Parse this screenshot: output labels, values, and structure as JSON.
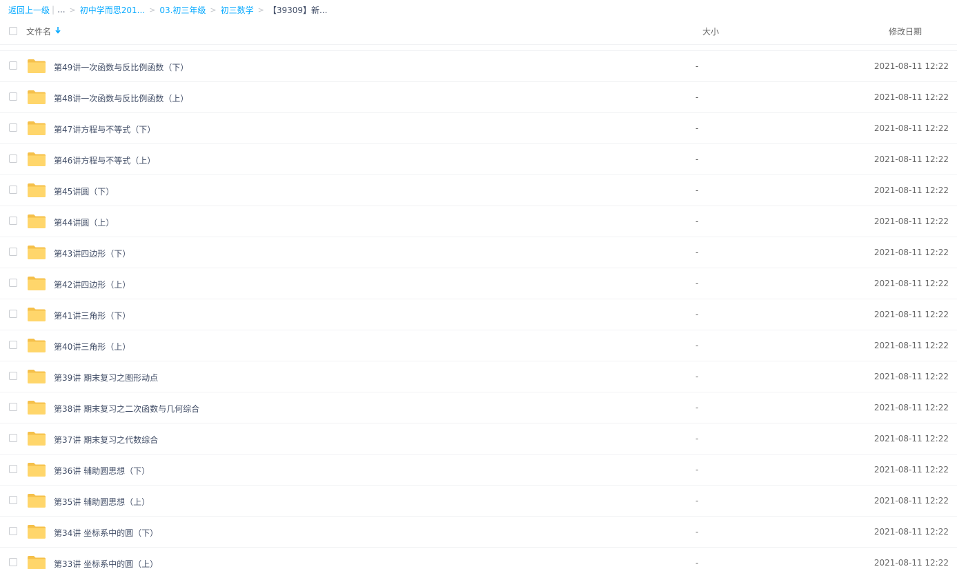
{
  "breadcrumb": {
    "back": "返回上一级",
    "ellipsis": "...",
    "crumbs": [
      "初中学而思201...",
      "03.初三年级",
      "初三数学"
    ],
    "current": "【39309】新..."
  },
  "header": {
    "name": "文件名",
    "sort_icon": "arrow-down-icon",
    "size": "大小",
    "date": "修改日期"
  },
  "rows": [
    {
      "name": "第49讲一次函数与反比例函数（下）",
      "size": "-",
      "date": "2021-08-11 12:22"
    },
    {
      "name": "第48讲一次函数与反比例函数（上）",
      "size": "-",
      "date": "2021-08-11 12:22"
    },
    {
      "name": "第47讲方程与不等式（下）",
      "size": "-",
      "date": "2021-08-11 12:22"
    },
    {
      "name": "第46讲方程与不等式（上）",
      "size": "-",
      "date": "2021-08-11 12:22"
    },
    {
      "name": "第45讲圆（下）",
      "size": "-",
      "date": "2021-08-11 12:22"
    },
    {
      "name": "第44讲圆（上）",
      "size": "-",
      "date": "2021-08-11 12:22"
    },
    {
      "name": "第43讲四边形（下）",
      "size": "-",
      "date": "2021-08-11 12:22"
    },
    {
      "name": "第42讲四边形（上）",
      "size": "-",
      "date": "2021-08-11 12:22"
    },
    {
      "name": "第41讲三角形（下）",
      "size": "-",
      "date": "2021-08-11 12:22"
    },
    {
      "name": "第40讲三角形（上）",
      "size": "-",
      "date": "2021-08-11 12:22"
    },
    {
      "name": "第39讲 期末复习之图形动点",
      "size": "-",
      "date": "2021-08-11 12:22"
    },
    {
      "name": "第38讲 期末复习之二次函数与几何综合",
      "size": "-",
      "date": "2021-08-11 12:22"
    },
    {
      "name": "第37讲 期末复习之代数综合",
      "size": "-",
      "date": "2021-08-11 12:22"
    },
    {
      "name": "第36讲 辅助圆思想（下）",
      "size": "-",
      "date": "2021-08-11 12:22"
    },
    {
      "name": "第35讲 辅助圆思想（上）",
      "size": "-",
      "date": "2021-08-11 12:22"
    },
    {
      "name": "第34讲 坐标系中的圆（下）",
      "size": "-",
      "date": "2021-08-11 12:22"
    },
    {
      "name": "第33讲 坐标系中的圆（上）",
      "size": "-",
      "date": "2021-08-11 12:22"
    }
  ],
  "colors": {
    "link": "#09aaff",
    "folder": "#ffd66b",
    "folder_tab": "#f5c04a",
    "text": "#424e67",
    "divider": "#f1f2f4"
  },
  "icons": {
    "row_icon": "folder-icon"
  }
}
